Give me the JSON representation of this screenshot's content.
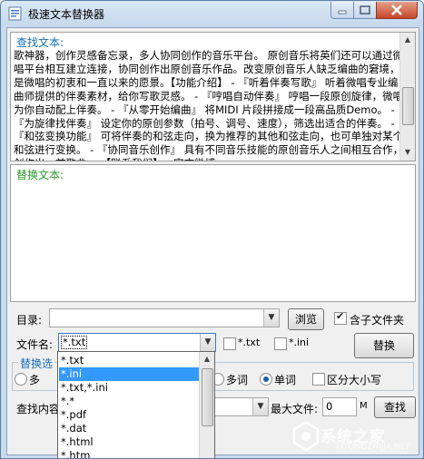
{
  "window": {
    "title": "极速文本替换器"
  },
  "find_panel": {
    "label": "查找文本:",
    "text": "歌神器，创作灵感备忘录，多人协同创作的音乐平台。 原创音乐将英们还可以通过微唱平台相互建立连接，协同创作出原创音乐作品。改变原创音乐人缺乏编曲的窘境，是微唱的初衷和一直以来的愿景。【功能介绍】 - 『听着伴奏写歌』 听着微唱专业编曲师提供的伴奏素材，给你写歌灵感。 - 『哼唱自动伴奏』 哼唱一段原创旋律，微唱为你自动配上伴奏。 - 『从零开始编曲』 将MIDI 片段拼接成一段高品质Demo。 - 『为旋律找伴奏』 设定你的原创参数（拍号、调号、速度），筛选出适合的伴奏。 - 『和弦变换功能』 可将伴奏的和弦走向，换为推荐的其他和弦走向，也可单独对某个和弦进行变换。 - 『协同音乐创作』 具有不同音乐技能的原创音乐人之间相互合作，创作出一首歌曲。 【联系我们】 - 官方微博:"
  },
  "replace_panel": {
    "label": "替换文本:",
    "text": ""
  },
  "directory": {
    "label": "目录:",
    "value": "",
    "browse_label": "浏览",
    "include_subfolders_label": "含子文件夹",
    "include_subfolders": true
  },
  "filename": {
    "label": "文件名:",
    "value": "*.txt",
    "quick_txt_label": "*.txt",
    "quick_ini_label": "*.ini",
    "quick_txt": false,
    "quick_ini": false
  },
  "replace_button": "替换",
  "options": {
    "group_label": "替换选",
    "left_radio_label": "多",
    "multi_word_label": "多词",
    "single_word_label": "单词",
    "single_word_selected": true,
    "case_sensitive_label": "区分大小写",
    "case_sensitive": false
  },
  "search_row": {
    "label": "查找内容",
    "max_file_label": "最大文件:",
    "max_file_value": "0",
    "max_file_unit": "M",
    "search_button": "查找"
  },
  "filename_dropdown": {
    "options": [
      "*.txt",
      "*.ini",
      "*.txt,*.ini",
      "*.*",
      "*.pdf",
      "*.dat",
      "*.html",
      "*.htm"
    ],
    "highlighted": "*.ini"
  },
  "watermark": {
    "text": "系统之家",
    "sub": "XITONGZHIJIA.NET"
  }
}
